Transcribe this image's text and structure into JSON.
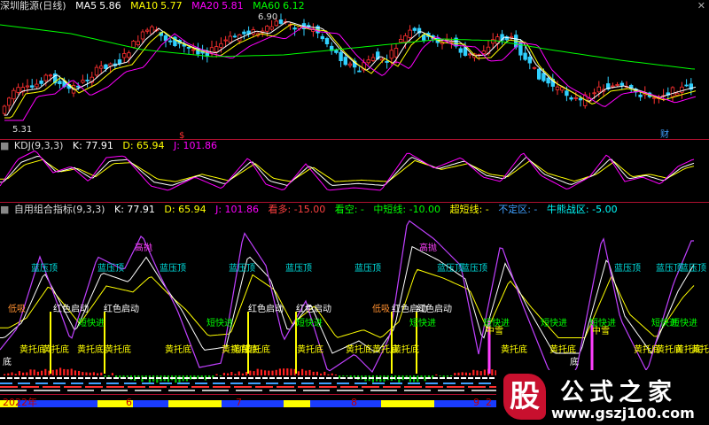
{
  "chart_data": [
    {
      "type": "candlestick",
      "title": "深圳能源(日线)",
      "series": [
        {
          "name": "MA5",
          "last_value": 5.86,
          "color": "#ffffff"
        },
        {
          "name": "MA10",
          "last_value": 5.77,
          "color": "#ffff00"
        },
        {
          "name": "MA20",
          "last_value": 5.81,
          "color": "#ff00ff"
        },
        {
          "name": "MA60",
          "last_value": 6.12,
          "color": "#00ff00"
        }
      ],
      "annotations": {
        "high": "6.90",
        "low": "5.31",
        "marker_1": "$",
        "marker_2": "财"
      }
    },
    {
      "type": "line",
      "title": "KDJ(9,3,3)",
      "series": [
        {
          "name": "K",
          "last_value": 77.91,
          "color": "#ffffff"
        },
        {
          "name": "D",
          "last_value": 65.94,
          "color": "#ffff00"
        },
        {
          "name": "J",
          "last_value": 101.86,
          "color": "#ff00ff"
        }
      ]
    },
    {
      "type": "line",
      "title": "自用组合指标(9,3,3)",
      "series": [
        {
          "name": "K",
          "last_value": 77.91,
          "color": "#ffffff"
        },
        {
          "name": "D",
          "last_value": 65.94,
          "color": "#ffff00"
        },
        {
          "name": "J",
          "last_value": 101.86,
          "color": "#ff00ff"
        },
        {
          "name": "看多",
          "last_value": -15.0,
          "color": "#ff4040"
        },
        {
          "name": "看空",
          "last_value": null,
          "color": "#00ff00"
        },
        {
          "name": "中短线",
          "last_value": -10.0,
          "color": "#00ff00"
        },
        {
          "name": "超短线",
          "last_value": null,
          "color": "#ffff00"
        },
        {
          "name": "不定区",
          "last_value": null,
          "color": "#40a0ff"
        },
        {
          "name": "牛熊战区",
          "last_value": -5.0,
          "color": "#00ffff"
        }
      ],
      "annotations": [
        "高抛",
        "蓝压顶",
        "蓝压顶",
        "蓝压顶",
        "蓝压顶",
        "蓝压顶",
        "蓝压顶",
        "高抛",
        "蓝压顶",
        "蓝压顶",
        "蓝压顶",
        "蓝压顶",
        "蓝压顶",
        "低吸",
        "红色启动",
        "红色启动",
        "红色启动",
        "红色启动",
        "红色启动",
        "低吸",
        "红色启动",
        "短快进",
        "短快进",
        "短快进",
        "短快进",
        "短快进",
        "短快进",
        "短快进",
        "短快进",
        "短快进",
        "黄托底",
        "黄托底",
        "黄托底",
        "黄托底",
        "黄托底",
        "黄托底",
        "黄托底",
        "黄托底",
        "黄托底",
        "黄托底",
        "黄托底",
        "黄托底",
        "黄托底",
        "黄托底",
        "黄托底",
        "黄托底",
        "黄托底",
        "黄托底",
        "底",
        "中雪",
        "中雪",
        "底"
      ]
    }
  ],
  "date_axis": {
    "labels": [
      "2022年",
      "6",
      "7",
      "8",
      "9",
      "2"
    ]
  },
  "watermark": {
    "logo_char": "股",
    "name": "公式之家",
    "url": "www.gszj100.com"
  }
}
